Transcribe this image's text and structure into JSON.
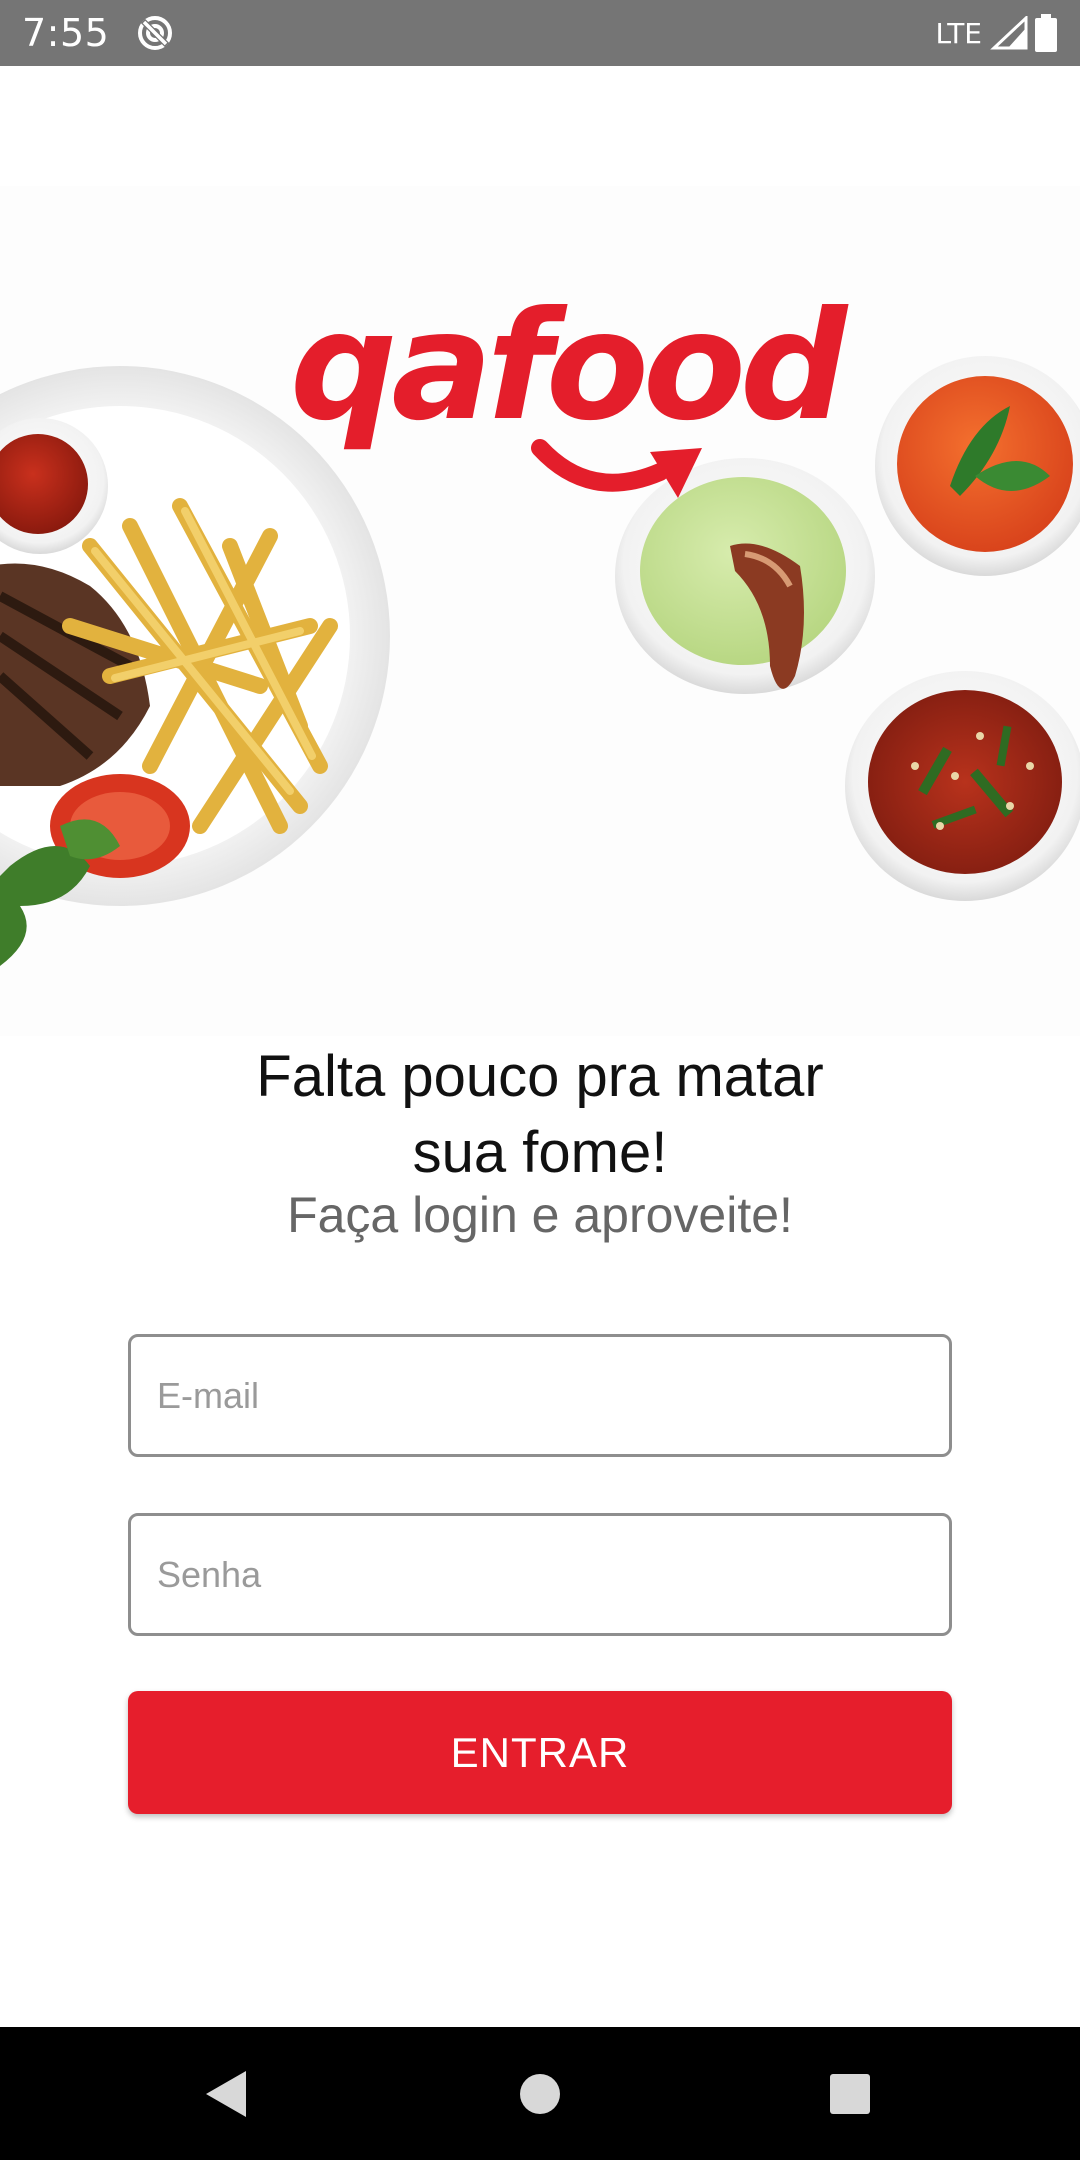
{
  "status_bar": {
    "time": "7:55",
    "network": "LTE",
    "icons": [
      "sync-icon",
      "signal-icon",
      "battery-icon"
    ]
  },
  "hero": {
    "logo_text": "qafood",
    "brand_color": "#e41e2b"
  },
  "headline": {
    "line1": "Falta pouco pra matar",
    "line2": "sua fome!"
  },
  "subheadline": "Faça login e aproveite!",
  "form": {
    "email_placeholder": "E-mail",
    "password_placeholder": "Senha",
    "email_value": "",
    "password_value": "",
    "submit_label": "ENTRAR",
    "submit_color": "#e61e2c"
  },
  "nav_bar": {
    "icons": [
      "back-icon",
      "home-icon",
      "recents-icon"
    ]
  }
}
